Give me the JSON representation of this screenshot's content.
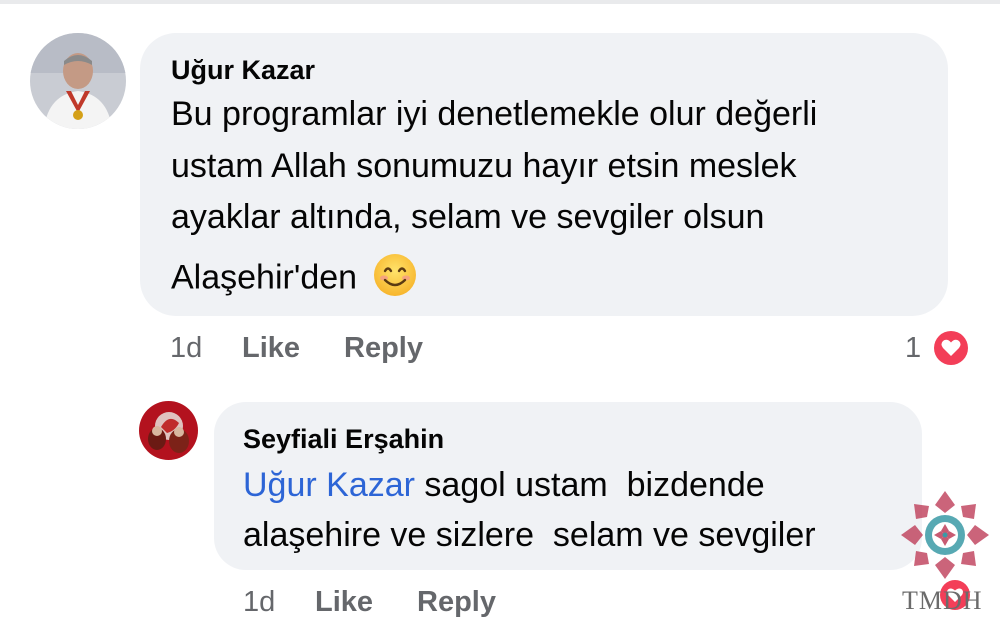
{
  "comment": {
    "author": "Uğur Kazar",
    "lines": [
      "Bu programlar iyi denetlemekle olur değerli",
      "ustam Allah sonumuzu hayır etsin meslek",
      "ayaklar altında, selam ve sevgiler olsun",
      "Alaşehir'den"
    ],
    "emoji": "smiling-face-emoji",
    "time": "1d",
    "like_label": "Like",
    "reply_label": "Reply",
    "reaction_count": "1",
    "reaction_icon": "heart-reaction-icon"
  },
  "reply": {
    "author": "Seyfiali Erşahin",
    "mention": "Uğur Kazar",
    "line1_rest": " sagol ustam  bizdende",
    "line2": "alaşehire ve sizlere  selam ve sevgiler",
    "time": "1d",
    "like_label": "Like",
    "reply_label": "Reply"
  },
  "watermark": {
    "text": "TMDH"
  },
  "colors": {
    "bubble": "#f0f2f5",
    "mention": "#2d65d6",
    "meta": "#65676b",
    "heart": "#f33e58"
  }
}
